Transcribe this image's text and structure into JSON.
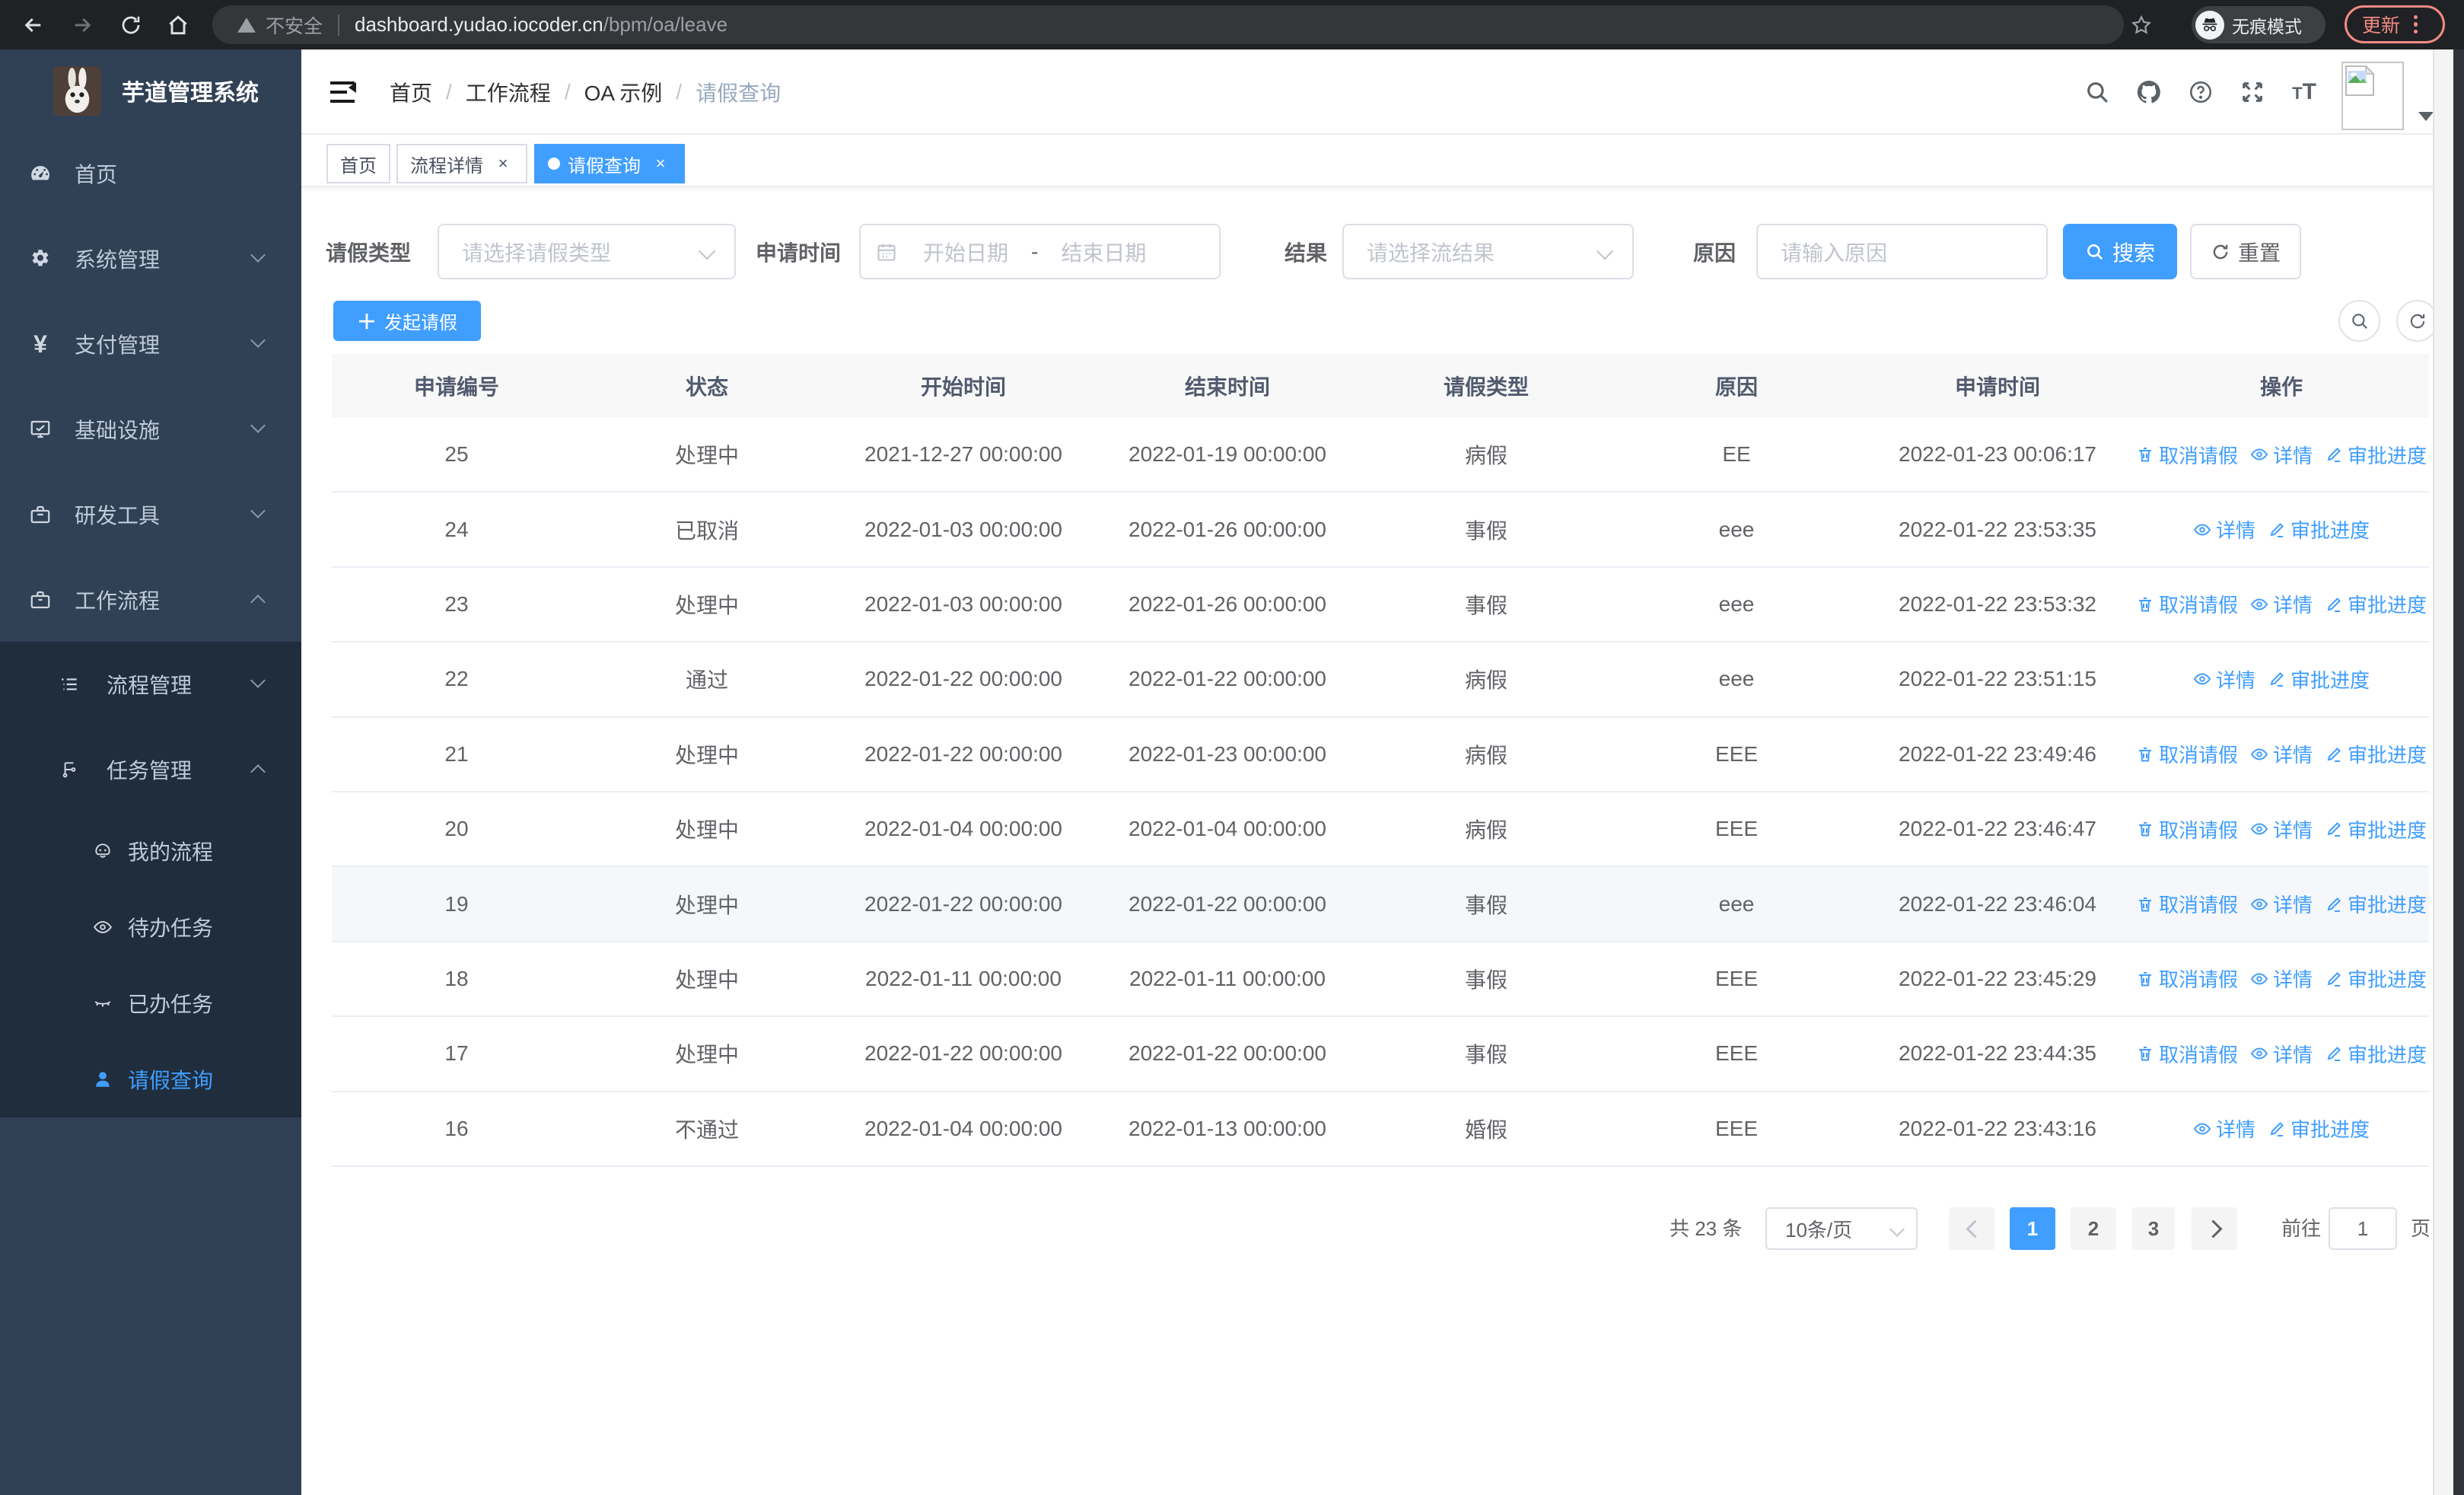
{
  "browser": {
    "security_chip": "不安全",
    "url_host": "dashboard.yudao.iocoder.cn",
    "url_path": "/bpm/oa/leave",
    "incognito_label": "无痕模式",
    "update_label": "更新"
  },
  "sidebar": {
    "logo_title": "芋道管理系统",
    "menu": [
      {
        "label": "首页"
      },
      {
        "label": "系统管理"
      },
      {
        "label": "支付管理"
      },
      {
        "label": "基础设施"
      },
      {
        "label": "研发工具"
      },
      {
        "label": "工作流程"
      }
    ],
    "submenu": [
      {
        "label": "流程管理"
      },
      {
        "label": "任务管理"
      }
    ],
    "task_items": [
      {
        "label": "我的流程"
      },
      {
        "label": "待办任务"
      },
      {
        "label": "已办任务"
      },
      {
        "label": "请假查询"
      }
    ]
  },
  "breadcrumb": {
    "items": [
      "首页",
      "工作流程",
      "OA 示例",
      "请假查询"
    ]
  },
  "tabs": [
    {
      "label": "首页"
    },
    {
      "label": "流程详情"
    },
    {
      "label": "请假查询"
    }
  ],
  "filters": {
    "leave_type_label": "请假类型",
    "leave_type_placeholder": "请选择请假类型",
    "apply_time_label": "申请时间",
    "start_date_placeholder": "开始日期",
    "range_separator": "-",
    "end_date_placeholder": "结束日期",
    "result_label": "结果",
    "result_placeholder": "请选择流结果",
    "reason_label": "原因",
    "reason_placeholder": "请输入原因",
    "search_label": "搜索",
    "reset_label": "重置"
  },
  "toolbar": {
    "create_label": "发起请假"
  },
  "table": {
    "headers": [
      "申请编号",
      "状态",
      "开始时间",
      "结束时间",
      "请假类型",
      "原因",
      "申请时间",
      "操作"
    ],
    "action_labels": {
      "cancel": "取消请假",
      "detail": "详情",
      "progress": "审批进度"
    },
    "rows": [
      {
        "id": "25",
        "status": "处理中",
        "start": "2021-12-27 00:00:00",
        "end": "2022-01-19 00:00:00",
        "type": "病假",
        "reason": "EE",
        "applied": "2022-01-23 00:06:17",
        "cancellable": true,
        "highlight": false
      },
      {
        "id": "24",
        "status": "已取消",
        "start": "2022-01-03 00:00:00",
        "end": "2022-01-26 00:00:00",
        "type": "事假",
        "reason": "eee",
        "applied": "2022-01-22 23:53:35",
        "cancellable": false,
        "highlight": false
      },
      {
        "id": "23",
        "status": "处理中",
        "start": "2022-01-03 00:00:00",
        "end": "2022-01-26 00:00:00",
        "type": "事假",
        "reason": "eee",
        "applied": "2022-01-22 23:53:32",
        "cancellable": true,
        "highlight": false
      },
      {
        "id": "22",
        "status": "通过",
        "start": "2022-01-22 00:00:00",
        "end": "2022-01-22 00:00:00",
        "type": "病假",
        "reason": "eee",
        "applied": "2022-01-22 23:51:15",
        "cancellable": false,
        "highlight": false
      },
      {
        "id": "21",
        "status": "处理中",
        "start": "2022-01-22 00:00:00",
        "end": "2022-01-23 00:00:00",
        "type": "病假",
        "reason": "EEE",
        "applied": "2022-01-22 23:49:46",
        "cancellable": true,
        "highlight": false
      },
      {
        "id": "20",
        "status": "处理中",
        "start": "2022-01-04 00:00:00",
        "end": "2022-01-04 00:00:00",
        "type": "病假",
        "reason": "EEE",
        "applied": "2022-01-22 23:46:47",
        "cancellable": true,
        "highlight": false
      },
      {
        "id": "19",
        "status": "处理中",
        "start": "2022-01-22 00:00:00",
        "end": "2022-01-22 00:00:00",
        "type": "事假",
        "reason": "eee",
        "applied": "2022-01-22 23:46:04",
        "cancellable": true,
        "highlight": true
      },
      {
        "id": "18",
        "status": "处理中",
        "start": "2022-01-11 00:00:00",
        "end": "2022-01-11 00:00:00",
        "type": "事假",
        "reason": "EEE",
        "applied": "2022-01-22 23:45:29",
        "cancellable": true,
        "highlight": false
      },
      {
        "id": "17",
        "status": "处理中",
        "start": "2022-01-22 00:00:00",
        "end": "2022-01-22 00:00:00",
        "type": "事假",
        "reason": "EEE",
        "applied": "2022-01-22 23:44:35",
        "cancellable": true,
        "highlight": false
      },
      {
        "id": "16",
        "status": "不通过",
        "start": "2022-01-04 00:00:00",
        "end": "2022-01-13 00:00:00",
        "type": "婚假",
        "reason": "EEE",
        "applied": "2022-01-22 23:43:16",
        "cancellable": false,
        "highlight": false
      }
    ]
  },
  "pagination": {
    "total": "共 23 条",
    "page_size": "10条/页",
    "pages": [
      "1",
      "2",
      "3"
    ],
    "active_page": "1",
    "goto_label": "前往",
    "goto_value": "1",
    "page_suffix": "页"
  }
}
